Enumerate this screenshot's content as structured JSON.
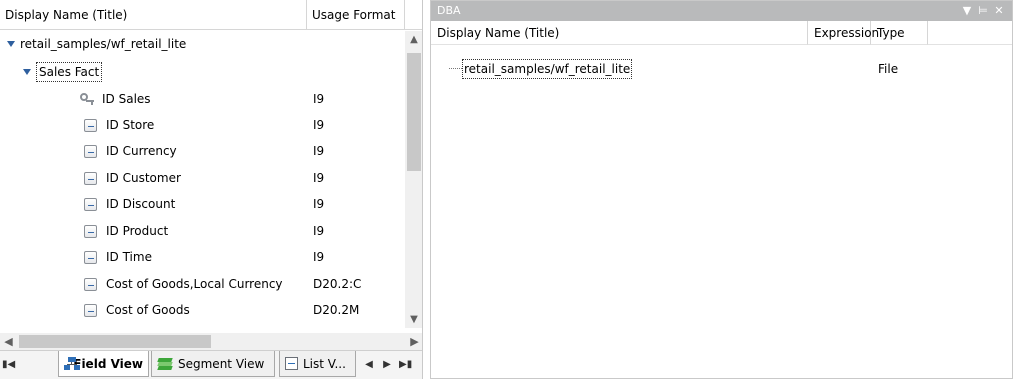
{
  "left_pane": {
    "columns": {
      "display_name": "Display Name (Title)",
      "usage_format": "Usage Format"
    },
    "tree": {
      "root_label": "retail_samples/wf_retail_lite",
      "folder_label": "Sales Fact",
      "fields": [
        {
          "name": "ID Sales",
          "format": "I9",
          "icon": "key-icon"
        },
        {
          "name": "ID Store",
          "format": "I9",
          "icon": "field-icon"
        },
        {
          "name": "ID Currency",
          "format": "I9",
          "icon": "field-icon"
        },
        {
          "name": "ID Customer",
          "format": "I9",
          "icon": "field-icon"
        },
        {
          "name": "ID Discount",
          "format": "I9",
          "icon": "field-icon"
        },
        {
          "name": "ID Product",
          "format": "I9",
          "icon": "field-icon"
        },
        {
          "name": "ID Time",
          "format": "I9",
          "icon": "field-icon"
        },
        {
          "name": "Cost of Goods,Local Currency",
          "format": "D20.2:C",
          "icon": "field-icon"
        },
        {
          "name": "Cost of Goods",
          "format": "D20.2M",
          "icon": "field-icon"
        }
      ]
    },
    "tabs": [
      {
        "label": "Field View",
        "icon": "field-view-icon",
        "active": true
      },
      {
        "label": "Segment View",
        "icon": "segment-view-icon",
        "active": false
      },
      {
        "label": "List V...",
        "icon": "list-view-icon",
        "active": false
      }
    ]
  },
  "right_pane": {
    "title": "DBA",
    "columns": {
      "display_name": "Display Name (Title)",
      "expression": "Expression",
      "type": "Type"
    },
    "rows": [
      {
        "name": "retail_samples/wf_retail_lite",
        "expression": "",
        "type": "File"
      }
    ]
  },
  "colors": {
    "titlebar": "#b9babb",
    "expander": "#2e5f9e",
    "scrollbar_track": "#f0f0f0",
    "scrollbar_thumb": "#c8c8c8"
  }
}
